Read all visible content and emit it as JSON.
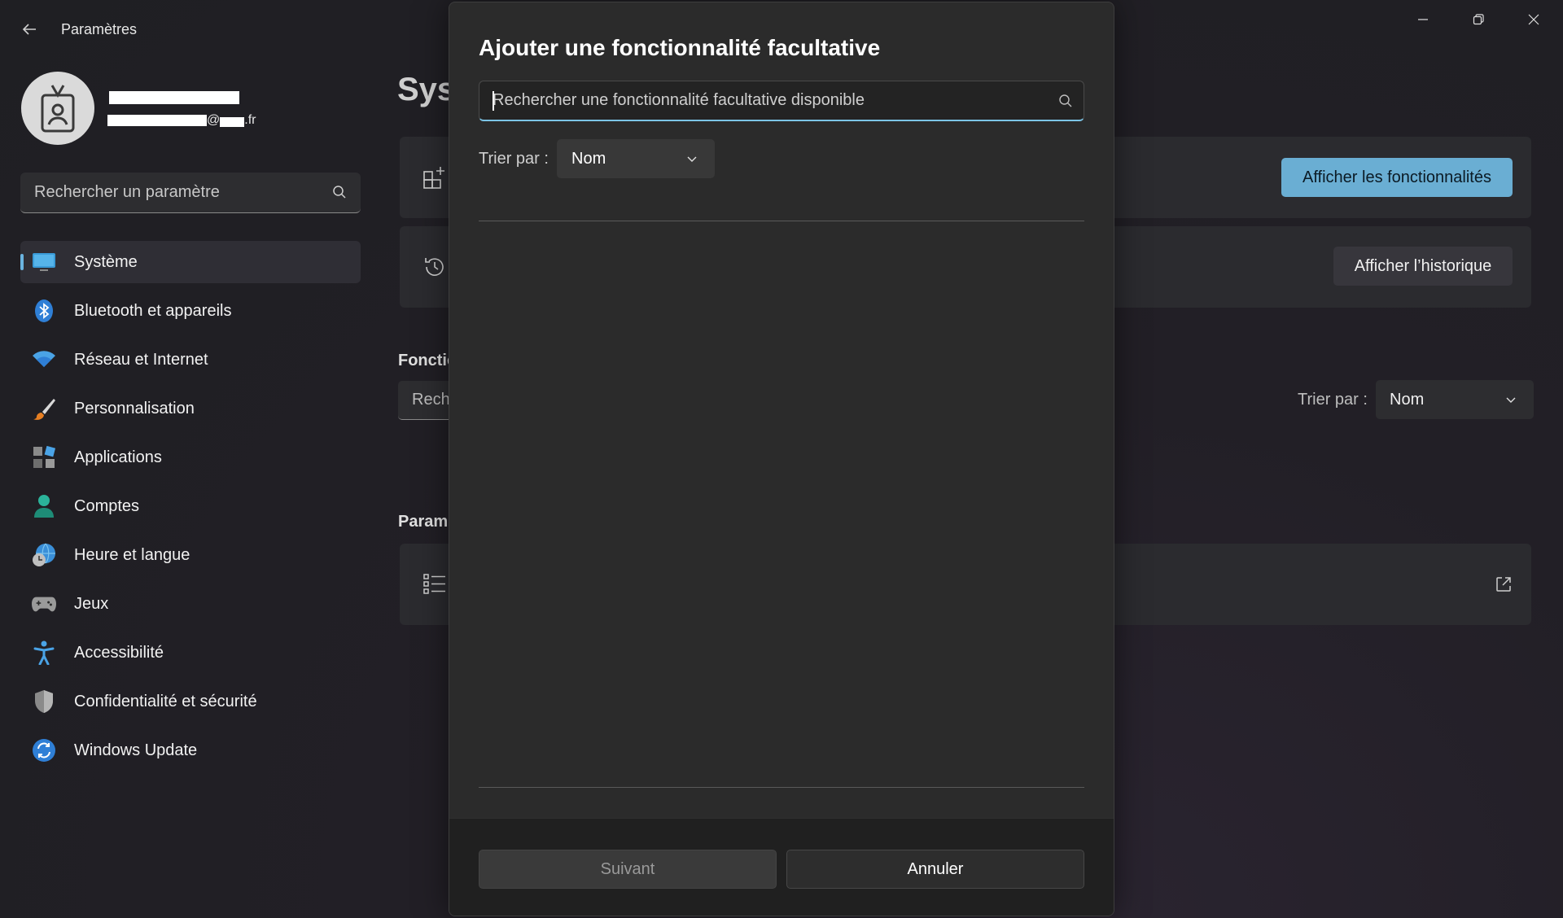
{
  "window": {
    "app_title": "Paramètres",
    "controls": {
      "minimize": "minimize-icon",
      "maximize": "restore-icon",
      "close": "close-icon"
    }
  },
  "profile": {
    "email_at": "@",
    "email_suffix": ".fr"
  },
  "sidebar": {
    "search_placeholder": "Rechercher un paramètre",
    "items": [
      {
        "label": "Système",
        "icon": "monitor-icon",
        "active": true
      },
      {
        "label": "Bluetooth et appareils",
        "icon": "bluetooth-icon"
      },
      {
        "label": "Réseau et Internet",
        "icon": "wifi-icon"
      },
      {
        "label": "Personnalisation",
        "icon": "brush-icon"
      },
      {
        "label": "Applications",
        "icon": "apps-icon"
      },
      {
        "label": "Comptes",
        "icon": "person-icon"
      },
      {
        "label": "Heure et langue",
        "icon": "globe-clock-icon"
      },
      {
        "label": "Jeux",
        "icon": "gamepad-icon"
      },
      {
        "label": "Accessibilité",
        "icon": "accessibility-icon"
      },
      {
        "label": "Confidentialité et sécurité",
        "icon": "shield-icon"
      },
      {
        "label": "Windows Update",
        "icon": "update-icon"
      }
    ]
  },
  "background": {
    "page_title": "Syst",
    "view_features_button": "Afficher les fonctionnalités",
    "view_history_button": "Afficher l’historique",
    "section_installed": "Fonctic",
    "search_partial": "Reche",
    "sort_label": "Trier par :",
    "sort_value": "Nom",
    "section_related": "Param"
  },
  "dialog": {
    "title": "Ajouter une fonctionnalité facultative",
    "search_placeholder": "Rechercher une fonctionnalité facultative disponible",
    "sort_label": "Trier par :",
    "sort_value": "Nom",
    "next_button": "Suivant",
    "cancel_button": "Annuler"
  },
  "colors": {
    "accent": "#6aaed3",
    "focus_underline": "#7cc4e6",
    "active_indicator": "#6bb4e0"
  }
}
